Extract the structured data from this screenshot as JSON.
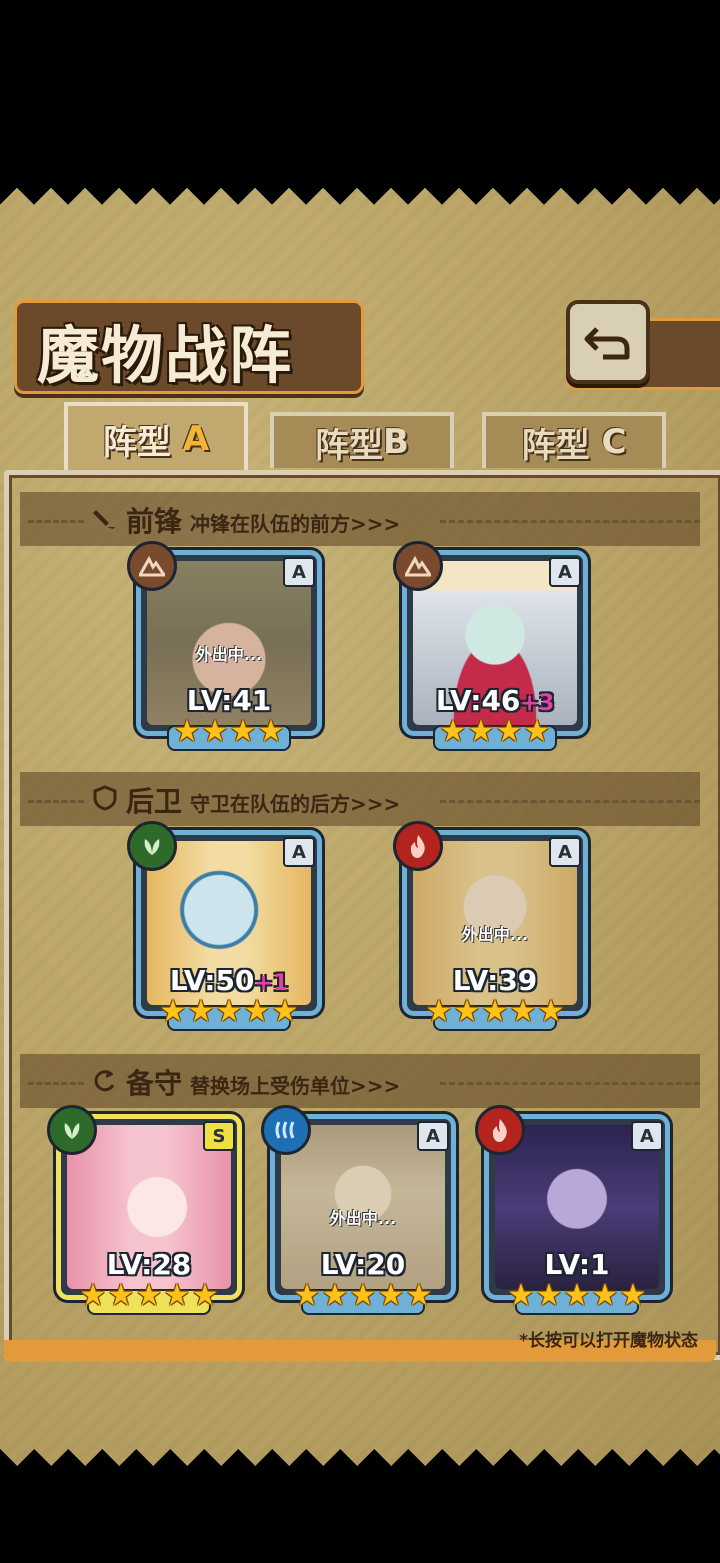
{
  "title": "魔物战阵",
  "tabs": [
    {
      "prefix": "阵型",
      "letter": "A"
    },
    {
      "prefix": "阵型",
      "letter": "B"
    },
    {
      "prefix": "阵型",
      "letter": "C"
    }
  ],
  "active_tab": "A",
  "sections": {
    "vanguard": {
      "name": "前锋",
      "desc": "冲锋在队伍的前方>>>"
    },
    "rearguard": {
      "name": "后卫",
      "desc": "守卫在队伍的后方>>>"
    },
    "reserve": {
      "name": "备守",
      "desc": "替换场上受伤单位>>>"
    }
  },
  "cards": {
    "v1": {
      "level": "LV:41",
      "plus": "",
      "rank": "A",
      "element": "earth-icon",
      "away": "外出中...",
      "stars": 4
    },
    "v2": {
      "level": "LV:46",
      "plus": "+3",
      "rank": "A",
      "element": "earth-icon",
      "away": "",
      "stars": 4
    },
    "r1": {
      "level": "LV:50",
      "plus": "+1",
      "rank": "A",
      "element": "leaf-icon",
      "away": "",
      "stars": 5
    },
    "r2": {
      "level": "LV:39",
      "plus": "",
      "rank": "A",
      "element": "fire-icon",
      "away": "外出中...",
      "stars": 5
    },
    "b1": {
      "level": "LV:28",
      "plus": "",
      "rank": "S",
      "element": "leaf-icon",
      "away": "",
      "stars": 5
    },
    "b2": {
      "level": "LV:20",
      "plus": "",
      "rank": "A",
      "element": "water-icon",
      "away": "外出中...",
      "stars": 5
    },
    "b3": {
      "level": "LV:1",
      "plus": "",
      "rank": "A",
      "element": "fire-icon",
      "away": "",
      "stars": 5
    }
  },
  "colors": {
    "earth": "#7a4a2e",
    "leaf": "#2e6b2a",
    "fire": "#b3241e",
    "water": "#1f6fb5",
    "star": "#ffc21a"
  },
  "footnote": "*长按可以打开魔物状态"
}
